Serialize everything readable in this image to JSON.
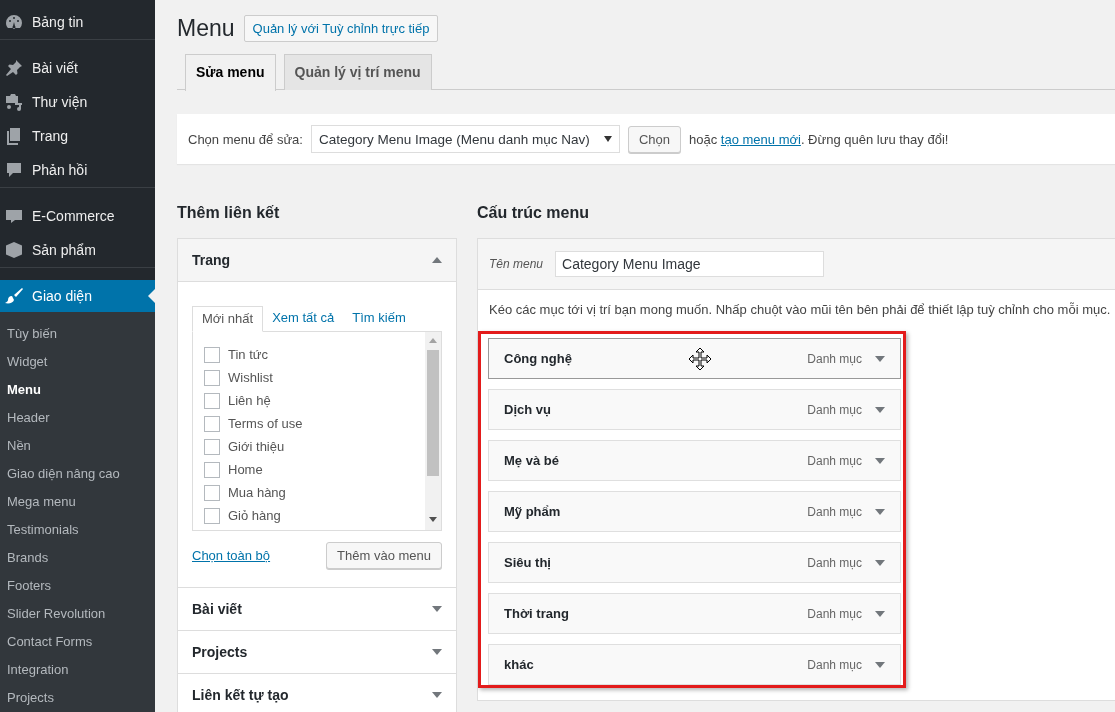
{
  "sidebar": {
    "sections": [
      [
        {
          "label": "Bảng tin",
          "selected": false
        }
      ],
      [
        {
          "label": "Bài viết",
          "selected": false
        },
        {
          "label": "Thư viện",
          "selected": false
        },
        {
          "label": "Trang",
          "selected": false
        },
        {
          "label": "Phản hồi",
          "selected": false
        }
      ],
      [
        {
          "label": "E-Commerce",
          "selected": false
        },
        {
          "label": "Sản phẩm",
          "selected": false
        }
      ],
      [
        {
          "label": "Giao diện",
          "selected": true,
          "children": [
            {
              "label": "Tùy biến",
              "selected": false
            },
            {
              "label": "Widget",
              "selected": false
            },
            {
              "label": "Menu",
              "selected": true
            },
            {
              "label": "Header",
              "selected": false
            },
            {
              "label": "Nền",
              "selected": false
            },
            {
              "label": "Giao diện nâng cao",
              "selected": false
            },
            {
              "label": "Mega menu",
              "selected": false
            },
            {
              "label": "Testimonials",
              "selected": false
            },
            {
              "label": "Brands",
              "selected": false
            },
            {
              "label": "Footers",
              "selected": false
            },
            {
              "label": "Slider Revolution",
              "selected": false
            },
            {
              "label": "Contact Forms",
              "selected": false
            },
            {
              "label": "Integration",
              "selected": false
            },
            {
              "label": "Projects",
              "selected": false
            }
          ]
        }
      ]
    ]
  },
  "page": {
    "title": "Menu",
    "action": "Quản lý với Tuỳ chỉnh trực tiếp"
  },
  "tabs": [
    {
      "label": "Sửa menu",
      "selected": true
    },
    {
      "label": "Quản lý vị trí menu",
      "selected": false
    }
  ],
  "select_bar": {
    "label": "Chọn menu để sửa:",
    "value": "Category Menu Image (Menu danh mục Nav)",
    "button": "Chọn",
    "note_before": "hoặc",
    "link": "tạo menu mới",
    "note_after": ". Đừng quên lưu thay đổi!"
  },
  "add_links": {
    "heading": "Thêm liên kết",
    "panels": [
      {
        "title": "Trang",
        "expanded": true,
        "tabs": [
          {
            "label": "Mới nhất",
            "selected": true
          },
          {
            "label": "Xem tất cả",
            "selected": false
          },
          {
            "label": "Tìm kiếm",
            "selected": false
          }
        ],
        "items": [
          {
            "label": "Tin tức",
            "checked": false
          },
          {
            "label": "Wishlist",
            "checked": false
          },
          {
            "label": "Liên hệ",
            "checked": false
          },
          {
            "label": "Terms of use",
            "checked": false
          },
          {
            "label": "Giới thiệu",
            "checked": false
          },
          {
            "label": "Home",
            "checked": false
          },
          {
            "label": "Mua hàng",
            "checked": false
          },
          {
            "label": "Giỏ hàng",
            "checked": false
          }
        ],
        "select_all": "Chọn toàn bộ",
        "add_button": "Thêm vào menu"
      },
      {
        "title": "Bài viết",
        "expanded": false
      },
      {
        "title": "Projects",
        "expanded": false
      },
      {
        "title": "Liên kết tự tạo",
        "expanded": false
      }
    ]
  },
  "structure": {
    "heading": "Cấu trúc menu",
    "name_label": "Tên menu",
    "name_value": "Category Menu Image",
    "instructions": "Kéo các mục tới vị trí bạn mong muốn. Nhấp chuột vào mũi tên bên phải để thiết lập tuỳ chỉnh cho mỗi mục.",
    "items": [
      {
        "title": "Công nghệ",
        "type": "Danh mục",
        "highlighted": true
      },
      {
        "title": "Dịch vụ",
        "type": "Danh mục",
        "highlighted": false
      },
      {
        "title": "Mẹ và bé",
        "type": "Danh mục",
        "highlighted": false
      },
      {
        "title": "Mỹ phẩm",
        "type": "Danh mục",
        "highlighted": false
      },
      {
        "title": "Siêu thị",
        "type": "Danh mục",
        "highlighted": false
      },
      {
        "title": "Thời trang",
        "type": "Danh mục",
        "highlighted": false
      },
      {
        "title": "khác",
        "type": "Danh mục",
        "highlighted": false
      }
    ]
  }
}
